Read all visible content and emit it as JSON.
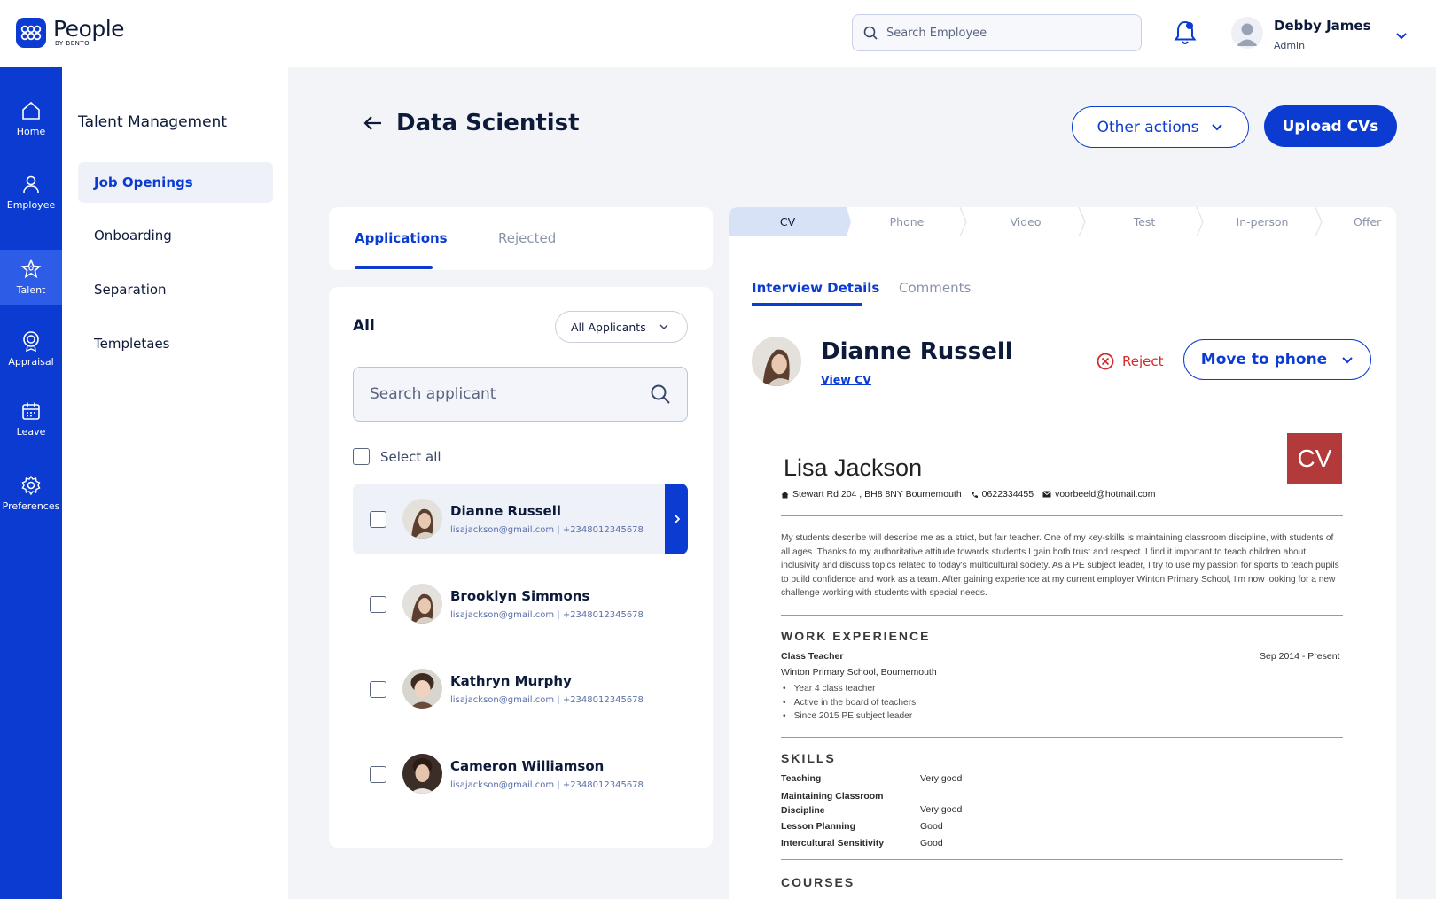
{
  "app": {
    "name": "People",
    "sub": "BY BENTO"
  },
  "topbar": {
    "search_placeholder": "Search Employee",
    "user_name": "Debby James",
    "user_role": "Admin"
  },
  "rail": [
    {
      "label": "Home",
      "icon": "home-icon"
    },
    {
      "label": "Employee",
      "icon": "user-icon"
    },
    {
      "label": "Talent",
      "icon": "talent-icon",
      "active": true
    },
    {
      "label": "Appraisal",
      "icon": "badge-icon"
    },
    {
      "label": "Leave",
      "icon": "calendar-icon"
    },
    {
      "label": "Preferences",
      "icon": "gear-icon"
    }
  ],
  "subnav": {
    "title": "Talent Management",
    "items": [
      {
        "label": "Job Openings",
        "active": true
      },
      {
        "label": "Onboarding"
      },
      {
        "label": "Separation"
      },
      {
        "label": "Templetaes"
      }
    ]
  },
  "page": {
    "title": "Data Scientist",
    "other_actions": "Other actions",
    "upload": "Upload CVs"
  },
  "applications": {
    "tabs": [
      "Applications",
      "Rejected"
    ],
    "filter_title": "All",
    "filter_value": "All Applicants",
    "search_placeholder": "Search applicant",
    "select_all": "Select all",
    "rows": [
      {
        "name": "Dianne Russell",
        "email": "lisajackson@gmail.com",
        "phone": "+2348012345678",
        "selected": true
      },
      {
        "name": "Brooklyn Simmons",
        "email": "lisajackson@gmail.com",
        "phone": "+2348012345678"
      },
      {
        "name": "Kathryn Murphy",
        "email": "lisajackson@gmail.com",
        "phone": "+2348012345678"
      },
      {
        "name": "Cameron Williamson",
        "email": "lisajackson@gmail.com",
        "phone": "+2348012345678"
      }
    ]
  },
  "detail": {
    "stages": [
      "CV",
      "Phone",
      "Video",
      "Test",
      "In-person",
      "Offer"
    ],
    "tabs": [
      "Interview Details",
      "Comments"
    ],
    "candidate_name": "Dianne Russell",
    "view_cv": "View CV",
    "reject": "Reject",
    "move": "Move to phone"
  },
  "cv": {
    "badge": "CV",
    "name": "Lisa Jackson",
    "address": "Stewart Rd 204 , BH8 8NY Bournemouth",
    "phone": "0622334455",
    "email": "voorbeeld@hotmail.com",
    "summary": "My students describe will describe me as a strict, but fair teacher. One of my key-skills is maintaining classroom discipline, with students of all ages. Thanks to my authoritative attitude towards students I gain both trust and respect. I find it important to teach children about inclusivity and discuss topics related to today's multicultural society. As a PE subject leader, I try to use my passion for sports to teach pupils to build confidence and work as a team. After gaining experience at my current employer Winton Primary School, I'm now looking for a new challenge working with students with special needs.",
    "work_heading": "WORK EXPERIENCE",
    "job_title": "Class Teacher",
    "job_dates": "Sep 2014 - Present",
    "job_employer": "Winton Primary School, Bournemouth",
    "job_bullets": [
      "Year 4 class teacher",
      "Active in the board of teachers",
      "Since 2015 PE subject leader"
    ],
    "skills_heading": "SKILLS",
    "skills": [
      {
        "name": "Teaching",
        "level": "Very good"
      },
      {
        "name": "Maintaining Classroom Discipline",
        "level": "Very good"
      },
      {
        "name": "Lesson Planning",
        "level": "Good"
      },
      {
        "name": "Intercultural Sensitivity",
        "level": "Good"
      }
    ],
    "courses_heading": "COURSES"
  }
}
